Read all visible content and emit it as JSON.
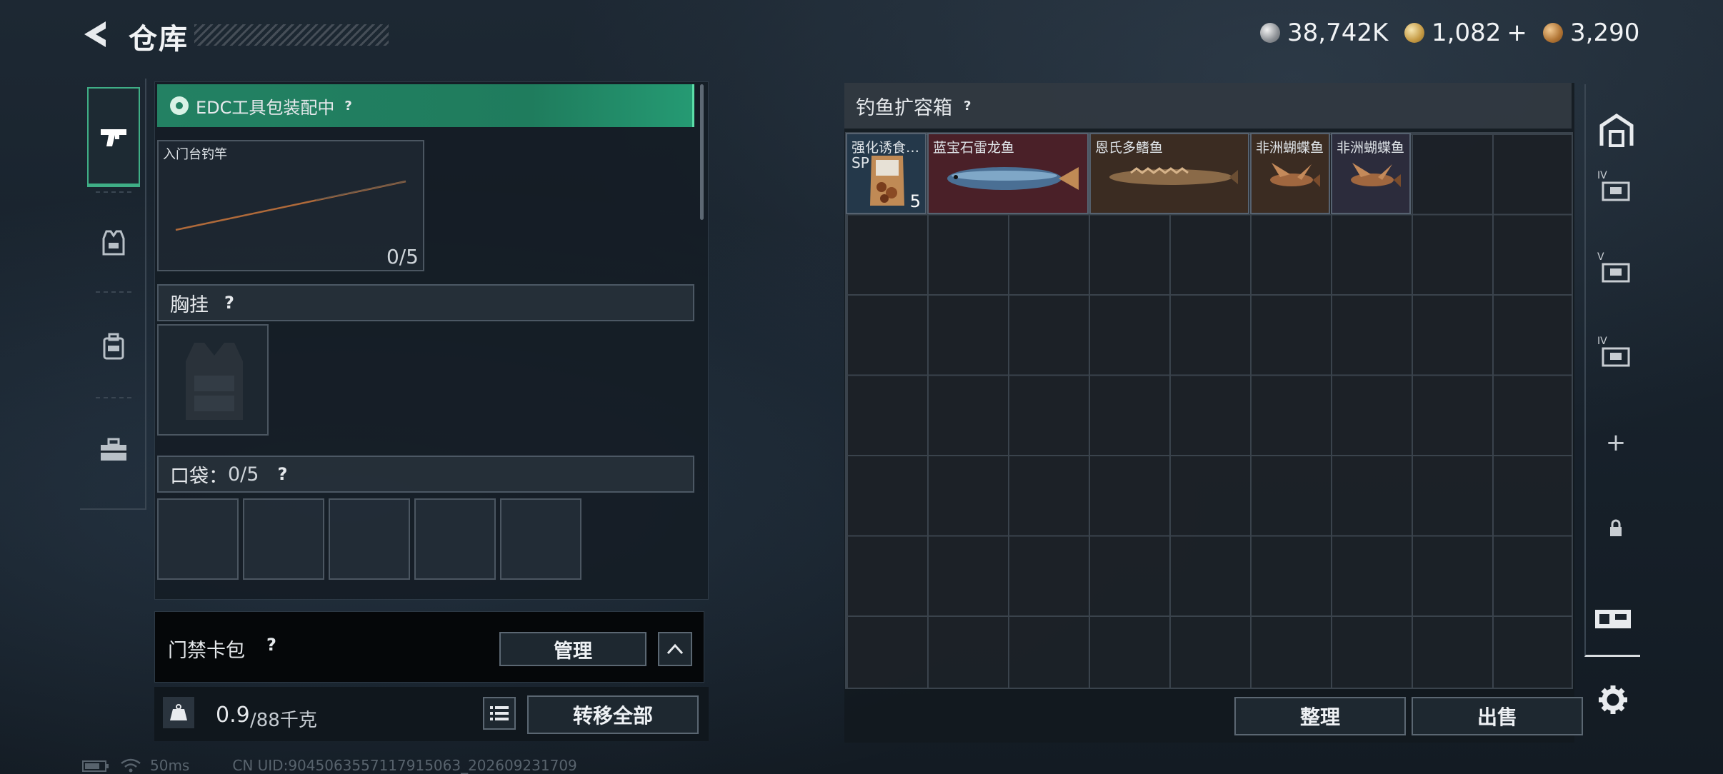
{
  "header": {
    "title": "仓库",
    "currencies": [
      {
        "icon": "silver-coin-icon",
        "value": "38,742K"
      },
      {
        "icon": "gold-coin-icon",
        "value": "1,082"
      },
      {
        "icon": "bronze-coin-icon",
        "value": "3,290"
      }
    ],
    "add_symbol": "+"
  },
  "left_rail": {
    "items": [
      {
        "name": "firearm-tab",
        "icon": "pistol-icon",
        "active": true
      },
      {
        "name": "gear-tab",
        "icon": "vest-icon",
        "active": false
      },
      {
        "name": "backpack-tab",
        "icon": "backpack-icon",
        "active": false
      },
      {
        "name": "toolbox-tab",
        "icon": "toolbox-icon",
        "active": false
      }
    ]
  },
  "equipment": {
    "edc_banner": "EDC工具包装配中",
    "rod_slot": {
      "label": "入门台钓竿",
      "count": "0/5"
    },
    "chest_rig": {
      "label": "胸挂"
    },
    "pockets": {
      "label_prefix": "口袋：",
      "count": "0/5"
    },
    "help_mark": "?"
  },
  "access_card": {
    "label": "门禁卡包",
    "manage": "管理",
    "help_mark": "?"
  },
  "weight": {
    "current": "0.9",
    "max": "/88千克"
  },
  "transfer_all": "转移全部",
  "storage": {
    "title": "钓鱼扩容箱",
    "help_mark": "?",
    "items": [
      {
        "label": "强化诱食…",
        "tag": "SP",
        "count": "5",
        "bg": "#24384a"
      },
      {
        "label": "蓝宝石雷龙鱼",
        "bg": "#4a2028"
      },
      {
        "label": "恩氏多鳍鱼",
        "bg": "#3b2c22"
      },
      {
        "label": "非洲蝴蝶鱼",
        "bg": "#3b2c22"
      },
      {
        "label": "非洲蝴蝶鱼",
        "bg": "#2c2c3c"
      }
    ],
    "sort_button": "整理",
    "sell_button": "出售"
  },
  "right_rail": {
    "levels": [
      "IV",
      "V",
      "IV"
    ],
    "add": "+"
  },
  "status": {
    "ping": "50ms",
    "uid": "CN UID:9045063557117915063_202609231709"
  },
  "colors": {
    "accent_green": "#238163",
    "panel_dark": "#141c24"
  }
}
